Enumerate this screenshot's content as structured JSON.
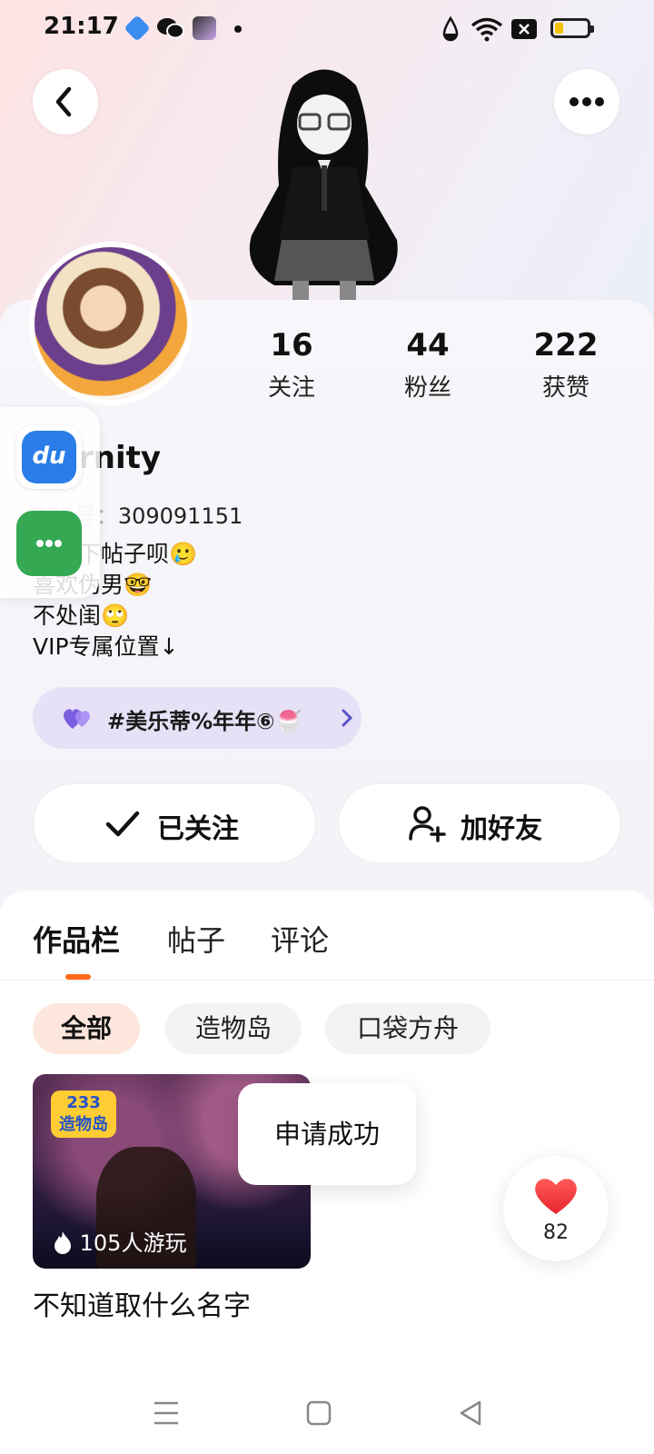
{
  "status_bar": {
    "time": "21:17"
  },
  "profile": {
    "username": "rnity",
    "id_label": "233号：",
    "id_value": "309091151",
    "bio_lines": [
      "下帖子呗🥲",
      "喜欢伪男🤓",
      "不处闺🙄",
      "VIP专属位置↓"
    ],
    "tag": "#美乐蒂%年年⑥🍧"
  },
  "stats": [
    {
      "num": "16",
      "label": "关注"
    },
    {
      "num": "44",
      "label": "粉丝"
    },
    {
      "num": "222",
      "label": "获赞"
    }
  ],
  "actions": {
    "followed": "已关注",
    "add_friend": "加好友"
  },
  "tabs": [
    "作品栏",
    "帖子",
    "评论"
  ],
  "chips": [
    "全部",
    "造物岛",
    "口袋方舟"
  ],
  "game": {
    "logo_line1": "233",
    "logo_line2": "造物岛",
    "plays": "105人游玩",
    "title": "不知道取什么名字"
  },
  "toast": "申请成功",
  "like_count": "82",
  "floating": {
    "du_label": "du"
  },
  "colors": {
    "accent": "#ff6a1a",
    "tag_bg": "#e6e1f6",
    "chip_active_bg": "#fde7dd",
    "heart": "#f23a3a"
  }
}
